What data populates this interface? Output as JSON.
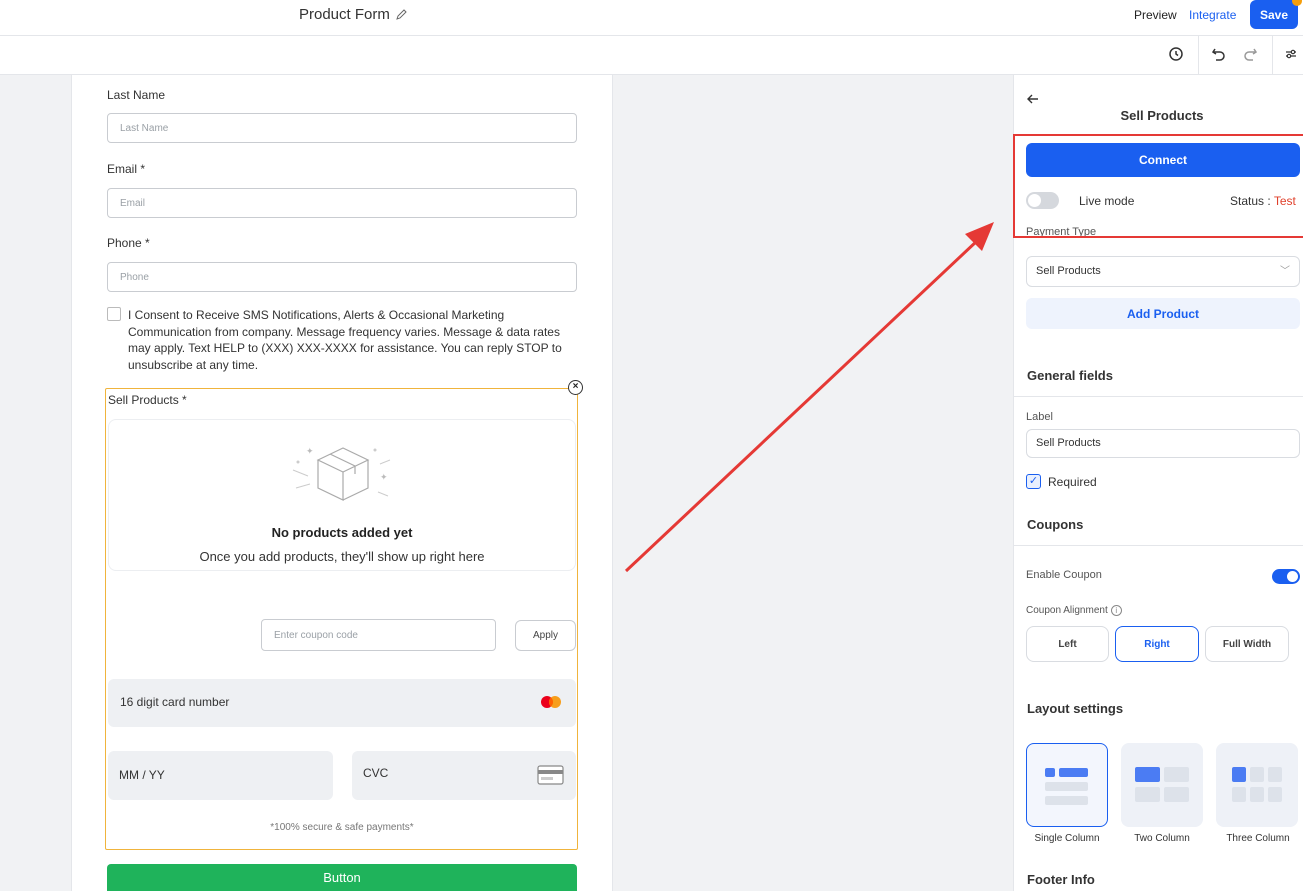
{
  "topbar": {
    "form_title": "Product Form",
    "preview_label": "Preview",
    "integrate_label": "Integrate",
    "save_label": "Save"
  },
  "form": {
    "last_name": {
      "label": "Last Name",
      "placeholder": "Last Name"
    },
    "email": {
      "label": "Email *",
      "placeholder": "Email"
    },
    "phone": {
      "label": "Phone *",
      "placeholder": "Phone"
    },
    "consent_text": "I Consent to Receive SMS Notifications, Alerts & Occasional Marketing Communication from company. Message frequency varies. Message & data rates may apply. Text HELP to (XXX) XXX-XXXX for assistance. You can reply STOP to unsubscribe at any time.",
    "sell_products": {
      "label": "Sell Products *",
      "empty_title": "No products added yet",
      "empty_subtitle": "Once you add products, they'll show up right here",
      "coupon_placeholder": "Enter coupon code",
      "apply_label": "Apply",
      "card_number_placeholder": "16 digit card number",
      "expiry_placeholder": "MM / YY",
      "cvc_placeholder": "CVC",
      "secure_note": "*100% secure & safe payments*"
    },
    "submit_label": "Button"
  },
  "panel": {
    "title": "Sell Products",
    "connect_label": "Connect",
    "live_mode_label": "Live mode",
    "live_mode_on": false,
    "status_label": "Status : ",
    "status_value": "Test",
    "payment_type_label": "Payment Type",
    "payment_type_value": "Sell Products",
    "add_product_label": "Add Product",
    "general_fields_title": "General fields",
    "label_caption": "Label",
    "label_value": "Sell Products",
    "required_label": "Required",
    "required_checked": true,
    "coupons_title": "Coupons",
    "enable_coupon_label": "Enable Coupon",
    "enable_coupon_on": true,
    "coupon_alignment_label": "Coupon Alignment",
    "alignment_options": [
      "Left",
      "Right",
      "Full Width"
    ],
    "alignment_selected": "Right",
    "layout_settings_title": "Layout settings",
    "layout_options": [
      "Single Column",
      "Two Column",
      "Three Column"
    ],
    "layout_selected": "Single Column",
    "footer_info_title": "Footer Info"
  },
  "colors": {
    "accent": "#1a5ff0",
    "submit_green": "#1fb35b",
    "highlight_red": "#e53935",
    "status_test": "#e0402b"
  }
}
